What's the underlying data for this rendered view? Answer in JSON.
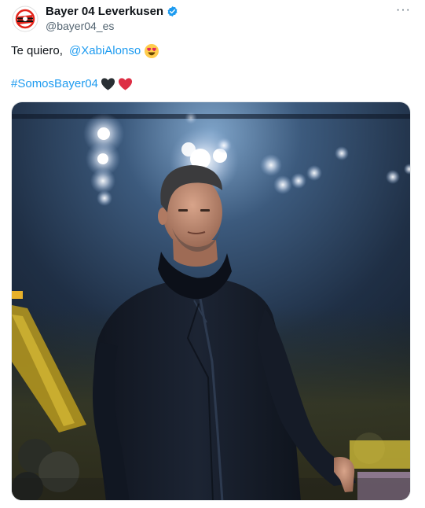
{
  "tweet": {
    "author": {
      "display_name": "Bayer 04 Leverkusen",
      "handle": "@bayer04_es",
      "avatar_icon": "club-crest-icon",
      "verified_icon": "verified-badge-icon"
    },
    "more_label": "···",
    "text": {
      "prefix": "Te quiero, ",
      "mention": "@XabiAlonso",
      "hashtag": "#SomosBayer04"
    },
    "emojis": [
      "heart-eyes-emoji",
      "black-heart-emoji",
      "red-heart-emoji"
    ],
    "media": {
      "type": "photo",
      "icon": "photo-image"
    }
  },
  "colors": {
    "link": "#1d9bf0",
    "text": "#0f1419",
    "secondary": "#536471",
    "club_red": "#e32219"
  }
}
